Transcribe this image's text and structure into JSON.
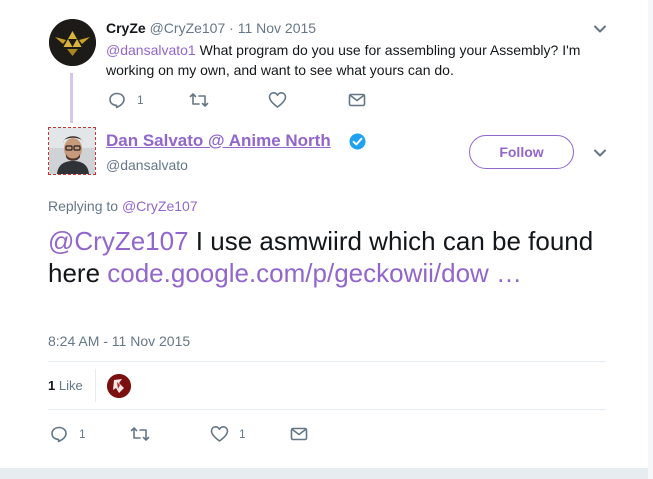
{
  "parent_tweet": {
    "name": "CryZe",
    "handle": "@CryZe107",
    "separator": "·",
    "date": "11 Nov 2015",
    "mention": "@dansalvato1",
    "text": " What program do you use for assembling your Assembly? I'm working on my own, and want to see what yours can do.",
    "reply_count": "1",
    "retweet_count": "",
    "like_count": ""
  },
  "main_tweet": {
    "name": "Dan Salvato @ Anime North",
    "handle": "@dansalvato",
    "follow_label": "Follow",
    "replying_prefix": "Replying to ",
    "replying_to": "@CryZe107",
    "mention": "@CryZe107",
    "text": " I use asmwiird which can be found here ",
    "link_text": "code.google.com/p/geckowii/dow",
    "link_ellipsis": " …",
    "timestamp": "8:24 AM - 11 Nov 2015",
    "like_count": "1",
    "like_label": "Like",
    "reply_count": "1",
    "retweet_count": "",
    "like_action_count": "1"
  },
  "colors": {
    "accent": "#9266cc",
    "text": "#14171a",
    "muted": "#657786"
  },
  "icons": [
    "reply-icon",
    "retweet-icon",
    "heart-icon",
    "mail-icon",
    "chevron-down-icon",
    "verified-badge-icon"
  ]
}
